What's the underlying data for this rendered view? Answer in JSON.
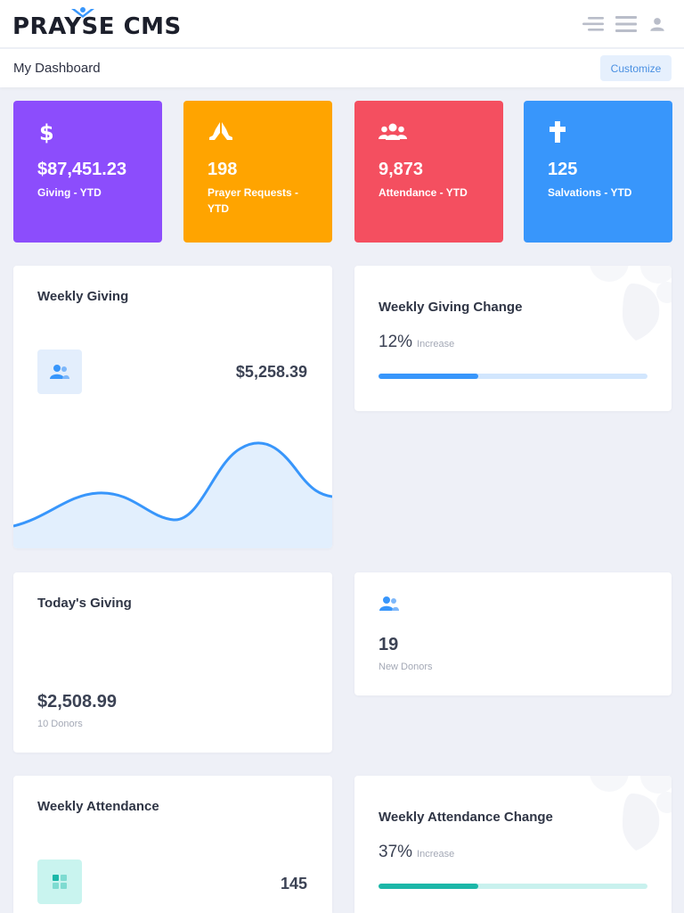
{
  "header": {
    "logo_text": "PRAYSE CMS",
    "icons": [
      "menu-right-icon",
      "menu-icon",
      "user-icon"
    ]
  },
  "subheader": {
    "title": "My Dashboard",
    "customize_label": "Customize"
  },
  "stats": [
    {
      "icon": "dollar-icon",
      "value": "$87,451.23",
      "label": "Giving - YTD",
      "color": "#8c4dfc"
    },
    {
      "icon": "praying-hands-icon",
      "value": "198",
      "label": "Prayer Requests - YTD",
      "color": "#ffa400"
    },
    {
      "icon": "users-icon",
      "value": "9,873",
      "label": "Attendance - YTD",
      "color": "#f44f60"
    },
    {
      "icon": "cross-icon",
      "value": "125",
      "label": "Salvations - YTD",
      "color": "#3896fb"
    }
  ],
  "weekly_giving": {
    "title": "Weekly Giving",
    "amount": "$5,258.39",
    "icon": "users-icon"
  },
  "weekly_giving_change": {
    "title": "Weekly Giving Change",
    "percent": "12%",
    "label": "Increase",
    "progress": 0.37,
    "color": "#3896fb",
    "track_color": "#d2e6fd"
  },
  "todays_giving": {
    "title": "Today's Giving",
    "amount": "$2,508.99",
    "donors": "10 Donors"
  },
  "new_donors": {
    "count": "19",
    "label": "New Donors",
    "icon": "users-icon"
  },
  "weekly_attendance": {
    "title": "Weekly Attendance",
    "count": "145",
    "icon": "grid-icon"
  },
  "weekly_attendance_change": {
    "title": "Weekly Attendance Change",
    "percent": "37%",
    "label": "Increase",
    "progress": 0.37,
    "color": "#1cb7a8",
    "track_color": "#c9f1ee"
  },
  "colors": {
    "accent_blue": "#3896fb",
    "background": "#eef0f7"
  }
}
